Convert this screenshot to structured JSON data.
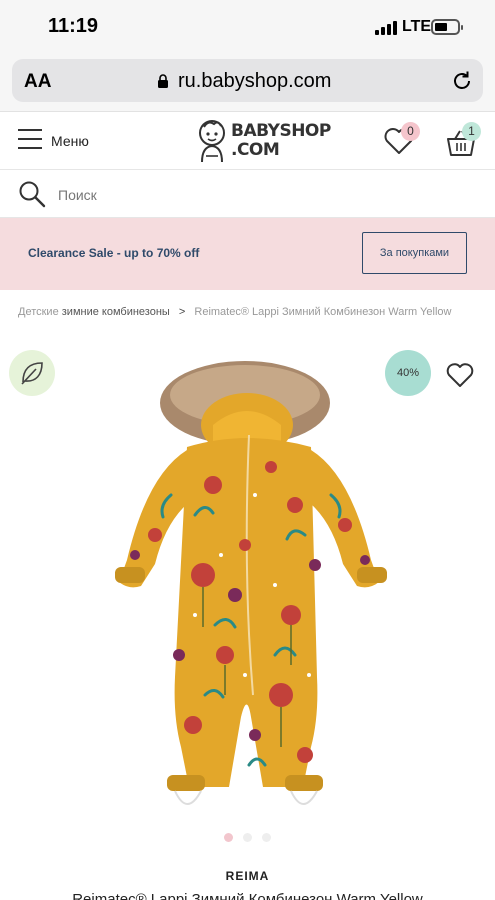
{
  "status_bar": {
    "time": "11:19",
    "network": "LTE"
  },
  "browser": {
    "text_size_label": "AA",
    "url": "ru.babyshop.com"
  },
  "header": {
    "menu_label": "Меню",
    "logo_line1": "BABYSHOP",
    "logo_line2": ".COM",
    "wishlist_count": "0",
    "cart_count": "1"
  },
  "search": {
    "placeholder": "Поиск"
  },
  "promo": {
    "text": "Clearance Sale - up to 70% off",
    "button_label": "За покупками"
  },
  "breadcrumb": {
    "part1": "Детские",
    "part2": "зимние комбинезоны",
    "separator": ">",
    "current": "Reimatec® Lappi Зимний Комбинезон Warm Yellow"
  },
  "product": {
    "discount": "40%",
    "brand": "REIMA",
    "title": "Reimatec® Lappi Зимний Комбинезон Warm Yellow",
    "image_slide_index": 1,
    "image_slide_count": 3
  },
  "colors": {
    "promo_bg": "#f5dcde",
    "accent_navy": "#2f4a6a",
    "discount_badge": "#a8ddd2",
    "wishlist_badge": "#f5c5cc",
    "cart_badge": "#bfe7d9",
    "product_yellow": "#e3a72a"
  }
}
